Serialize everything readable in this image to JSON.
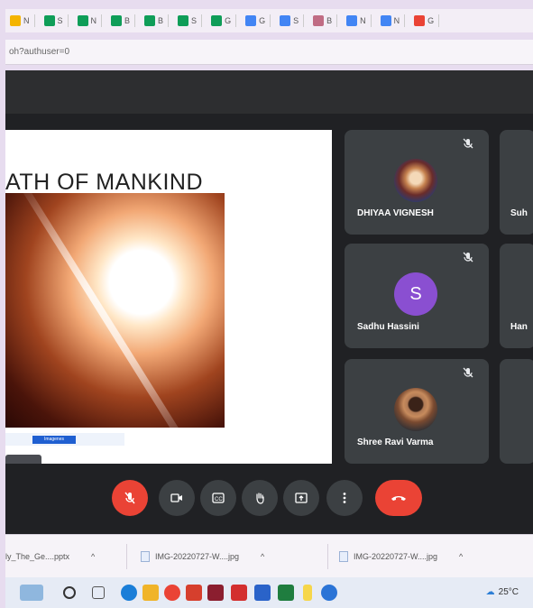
{
  "bookmarks": [
    {
      "icon": "slides-icon",
      "label": "N",
      "color": "#f4b400"
    },
    {
      "icon": "drive-icon",
      "label": "S",
      "color": "#0f9d58"
    },
    {
      "icon": "sheets-icon",
      "label": "N",
      "color": "#0f9d58"
    },
    {
      "icon": "sheets-icon",
      "label": "B",
      "color": "#0f9d58"
    },
    {
      "icon": "sheets-icon",
      "label": "B",
      "color": "#0f9d58"
    },
    {
      "icon": "sheets-icon",
      "label": "S",
      "color": "#0f9d58"
    },
    {
      "icon": "maps-pin-icon",
      "label": "G",
      "color": "#0f9d58"
    },
    {
      "icon": "gmail-icon",
      "label": "G",
      "color": "#4285f4"
    },
    {
      "icon": "docs-icon",
      "label": "S",
      "color": "#4285f4"
    },
    {
      "icon": "settings-icon",
      "label": "B",
      "color": "#c06c84"
    },
    {
      "icon": "link-icon",
      "label": "N",
      "color": "#4285f4"
    },
    {
      "icon": "link-icon",
      "label": "N",
      "color": "#4285f4"
    },
    {
      "icon": "google-icon",
      "label": "G",
      "color": "#ea4335"
    }
  ],
  "url_fragment": "oh?authuser=0",
  "slide": {
    "title": "ATH OF MANKIND",
    "caption_chip": "Imagenes"
  },
  "participants": [
    {
      "name": "DHIYAA VIGNESH",
      "avatar": "photo1"
    },
    {
      "name": "Suh",
      "avatar": "none"
    },
    {
      "name": "Sadhu Hassini",
      "avatar": "letter",
      "letter": "S"
    },
    {
      "name": "Han",
      "avatar": "none"
    },
    {
      "name": "Shree Ravi Varma",
      "avatar": "photo2"
    },
    {
      "name": "",
      "avatar": "none"
    }
  ],
  "controls": {
    "mic": "mic-off-icon",
    "camera": "camera-icon",
    "captions": "captions-icon",
    "hand": "raise-hand-icon",
    "present": "present-screen-icon",
    "more": "more-options-icon",
    "hangup": "end-call-icon"
  },
  "downloads": [
    {
      "name": "ly_The_Ge....pptx"
    },
    {
      "name": "IMG-20220727-W....jpg"
    },
    {
      "name": "IMG-20220727-W....jpg"
    }
  ],
  "taskbar": {
    "temperature": "25°C"
  }
}
